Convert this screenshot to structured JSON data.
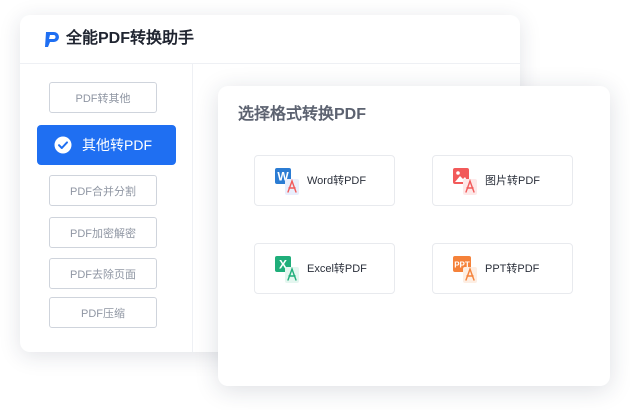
{
  "app": {
    "title": "全能PDF转换助手"
  },
  "sidebar": {
    "items": [
      {
        "label": "PDF转其他",
        "active": false
      },
      {
        "label": "其他转PDF",
        "active": true
      },
      {
        "label": "PDF合并分割",
        "active": false
      },
      {
        "label": "PDF加密解密",
        "active": false
      },
      {
        "label": "PDF去除页面",
        "active": false
      },
      {
        "label": "PDF压缩",
        "active": false
      }
    ]
  },
  "panel": {
    "title": "选择格式转换PDF",
    "options": [
      {
        "label": "Word转PDF",
        "icon": "word-icon",
        "badge": "W",
        "color": "#2b7cd3"
      },
      {
        "label": "图片转PDF",
        "icon": "image-icon",
        "badge": "",
        "color": "#f25a5a"
      },
      {
        "label": "Excel转PDF",
        "icon": "excel-icon",
        "badge": "X",
        "color": "#1fae7a"
      },
      {
        "label": "PPT转PDF",
        "icon": "ppt-icon",
        "badge": "PPT",
        "color": "#f5823a"
      }
    ]
  },
  "colors": {
    "accent": "#1f6ff2",
    "pdf_badge": "#e9eefc",
    "pdf_stroke": "#f25a5a"
  }
}
